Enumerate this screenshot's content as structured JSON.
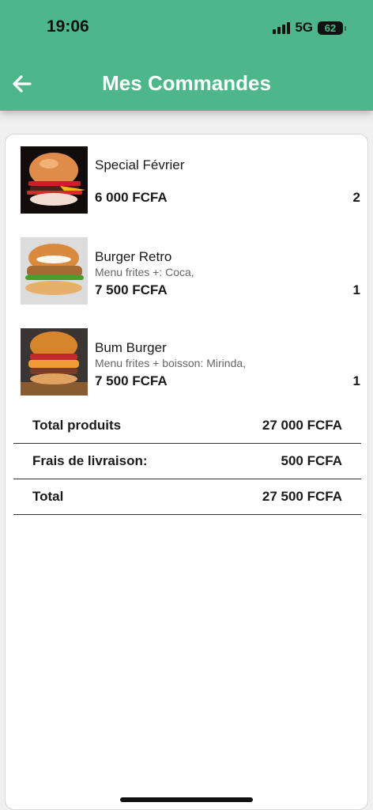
{
  "status_bar": {
    "time": "19:06",
    "network": "5G",
    "battery": "62"
  },
  "header": {
    "title": "Mes Commandes",
    "back_icon": "arrow-left-icon"
  },
  "colors": {
    "primary": "#4db68a",
    "text": "#1a1a1a",
    "muted": "#666666"
  },
  "orders": [
    {
      "name": "Special Février",
      "details": "",
      "price": "6 000 FCFA",
      "quantity": "2"
    },
    {
      "name": "Burger Retro",
      "details": "Menu frites +: Coca,",
      "price": "7 500 FCFA",
      "quantity": "1"
    },
    {
      "name": "Bum Burger",
      "details": "Menu frites + boisson: Mirinda,",
      "price": "7 500 FCFA",
      "quantity": "1"
    }
  ],
  "summary": {
    "products_label": "Total produits",
    "products_value": "27 000 FCFA",
    "delivery_label": "Frais de livraison:",
    "delivery_value": "500 FCFA",
    "total_label": "Total",
    "total_value": "27 500 FCFA"
  }
}
